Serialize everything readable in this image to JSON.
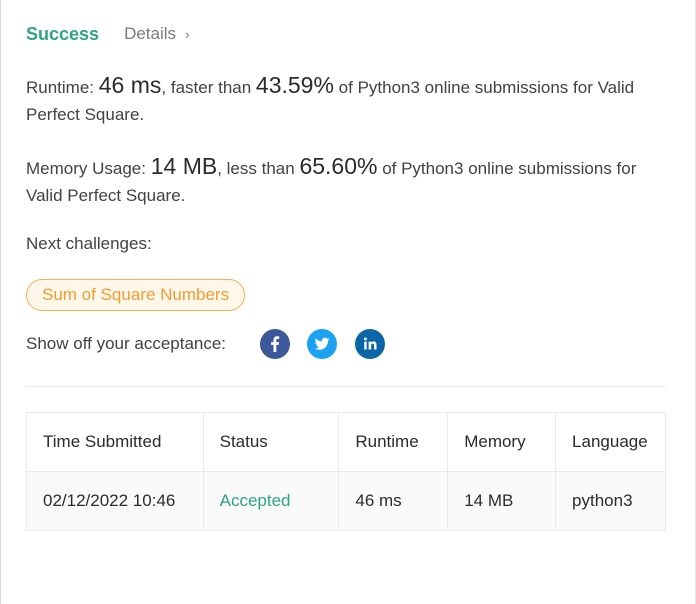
{
  "header": {
    "status": "Success",
    "details_label": "Details",
    "details_chevron": "›"
  },
  "runtime": {
    "label": "Runtime:",
    "value": "46 ms",
    "comparison": ", faster than",
    "percent": "43.59%",
    "suffix": "of Python3 online submissions for Valid Perfect Square."
  },
  "memory": {
    "label": "Memory Usage:",
    "value": "14 MB",
    "comparison": ", less than",
    "percent": "65.60%",
    "suffix": "of Python3 online submissions for Valid Perfect Square."
  },
  "next_challenges": {
    "label": "Next challenges:",
    "items": [
      "Sum of Square Numbers"
    ]
  },
  "share": {
    "label": "Show off your acceptance:",
    "icons": [
      "facebook-icon",
      "twitter-icon",
      "linkedin-icon"
    ]
  },
  "submissions": {
    "columns": [
      "Time Submitted",
      "Status",
      "Runtime",
      "Memory",
      "Language"
    ],
    "rows": [
      {
        "time": "02/12/2022 10:46",
        "status": "Accepted",
        "runtime": "46 ms",
        "memory": "14 MB",
        "language": "python3"
      }
    ]
  },
  "colors": {
    "success": "#2fa287",
    "pill_border": "#f7b05a",
    "pill_text": "#f29b32",
    "facebook": "#3b5998",
    "twitter": "#1da1f2",
    "linkedin": "#0b66a8"
  }
}
